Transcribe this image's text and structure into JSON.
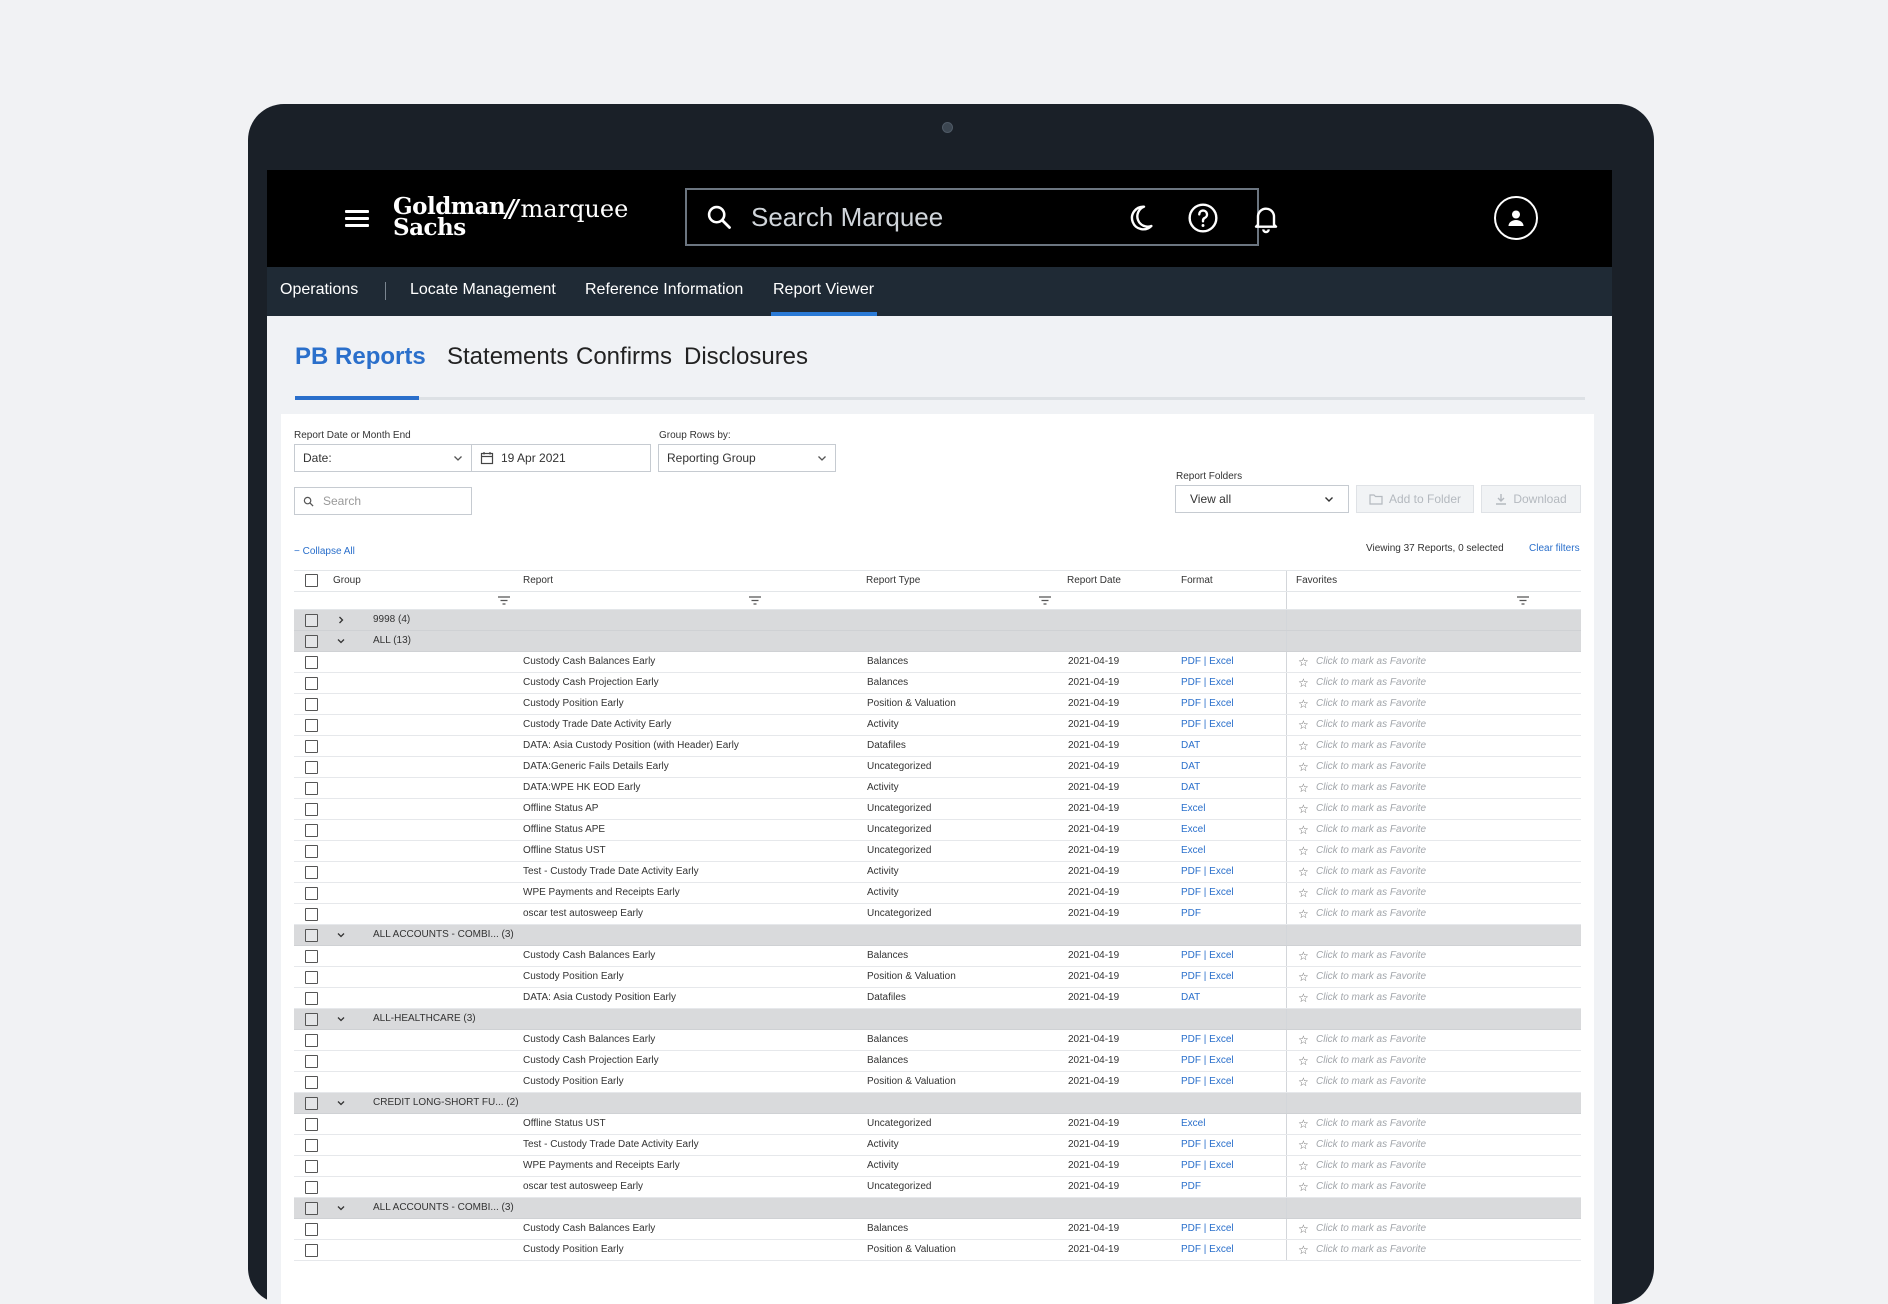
{
  "app": {
    "logo_line1": "Goldman",
    "logo_line2": "Sachs",
    "logo_product": "marquee",
    "search_placeholder": "Search Marquee"
  },
  "icons": [
    "menu-icon",
    "search-icon",
    "moon-icon",
    "help-icon",
    "bell-icon",
    "user-icon",
    "calendar-icon",
    "chevron-down-icon",
    "download-icon",
    "folder-icon",
    "filter-icon",
    "star-icon",
    "chevron-right-icon"
  ],
  "nav": [
    "Operations",
    "Locate Management",
    "Reference Information",
    "Report Viewer"
  ],
  "nav_active": "Report Viewer",
  "tabs": [
    "PB Reports",
    "Statements",
    "Confirms",
    "Disclosures"
  ],
  "tab_active": "PB Reports",
  "filters": {
    "date_label": "Report Date or Month End",
    "date_mode": "Date:",
    "date_value": "19 Apr 2021",
    "group_label": "Group Rows by:",
    "group_value": "Reporting Group",
    "search_placeholder": "Search",
    "folders_label": "Report Folders",
    "folders_value": "View all",
    "add_to_folder": "Add to Folder",
    "download": "Download",
    "collapse_all": "Collapse All",
    "viewing": "Viewing 37 Reports, 0 selected",
    "clear_filters": "Clear filters"
  },
  "columns": [
    "Group",
    "Report",
    "Report Type",
    "Report Date",
    "Format",
    "Favorites"
  ],
  "fav_text": "Click to mark as Favorite",
  "rows": [
    {
      "group": "9998 (4)",
      "expanded": false
    },
    {
      "group": "ALL (13)",
      "expanded": true
    },
    {
      "report": "Custody Cash Balances Early",
      "type": "Balances",
      "date": "2021-04-19",
      "format": "PDF | Excel"
    },
    {
      "report": "Custody Cash Projection Early",
      "type": "Balances",
      "date": "2021-04-19",
      "format": "PDF | Excel"
    },
    {
      "report": "Custody Position Early",
      "type": "Position & Valuation",
      "date": "2021-04-19",
      "format": "PDF | Excel"
    },
    {
      "report": "Custody Trade Date Activity Early",
      "type": "Activity",
      "date": "2021-04-19",
      "format": "PDF | Excel"
    },
    {
      "report": "DATA: Asia Custody Position (with Header) Early",
      "type": "Datafiles",
      "date": "2021-04-19",
      "format": "DAT"
    },
    {
      "report": "DATA:Generic Fails Details Early",
      "type": "Uncategorized",
      "date": "2021-04-19",
      "format": "DAT"
    },
    {
      "report": "DATA:WPE HK EOD Early",
      "type": "Activity",
      "date": "2021-04-19",
      "format": "DAT"
    },
    {
      "report": "Offline Status AP",
      "type": "Uncategorized",
      "date": "2021-04-19",
      "format": "Excel"
    },
    {
      "report": "Offline Status APE",
      "type": "Uncategorized",
      "date": "2021-04-19",
      "format": "Excel"
    },
    {
      "report": "Offline Status UST",
      "type": "Uncategorized",
      "date": "2021-04-19",
      "format": "Excel"
    },
    {
      "report": "Test - Custody Trade Date Activity Early",
      "type": "Activity",
      "date": "2021-04-19",
      "format": "PDF | Excel"
    },
    {
      "report": "WPE Payments and Receipts Early",
      "type": "Activity",
      "date": "2021-04-19",
      "format": "PDF | Excel"
    },
    {
      "report": "oscar test autosweep Early",
      "type": "Uncategorized",
      "date": "2021-04-19",
      "format": "PDF"
    },
    {
      "group": "ALL ACCOUNTS - COMBI... (3)",
      "expanded": true
    },
    {
      "report": "Custody Cash Balances Early",
      "type": "Balances",
      "date": "2021-04-19",
      "format": "PDF | Excel"
    },
    {
      "report": "Custody Position Early",
      "type": "Position & Valuation",
      "date": "2021-04-19",
      "format": "PDF | Excel"
    },
    {
      "report": "DATA: Asia Custody Position Early",
      "type": "Datafiles",
      "date": "2021-04-19",
      "format": "DAT"
    },
    {
      "group": "ALL-HEALTHCARE (3)",
      "expanded": true
    },
    {
      "report": "Custody Cash Balances Early",
      "type": "Balances",
      "date": "2021-04-19",
      "format": "PDF | Excel"
    },
    {
      "report": "Custody Cash Projection Early",
      "type": "Balances",
      "date": "2021-04-19",
      "format": "PDF | Excel"
    },
    {
      "report": "Custody Position Early",
      "type": "Position & Valuation",
      "date": "2021-04-19",
      "format": "PDF | Excel"
    },
    {
      "group": "CREDIT LONG-SHORT FU... (2)",
      "expanded": true
    },
    {
      "report": "Offline Status UST",
      "type": "Uncategorized",
      "date": "2021-04-19",
      "format": "Excel"
    },
    {
      "report": "Test - Custody Trade Date Activity Early",
      "type": "Activity",
      "date": "2021-04-19",
      "format": "PDF | Excel"
    },
    {
      "report": "WPE Payments and Receipts Early",
      "type": "Activity",
      "date": "2021-04-19",
      "format": "PDF | Excel"
    },
    {
      "report": "oscar test autosweep Early",
      "type": "Uncategorized",
      "date": "2021-04-19",
      "format": "PDF"
    },
    {
      "group": "ALL ACCOUNTS - COMBI... (3)",
      "expanded": true
    },
    {
      "report": "Custody Cash Balances Early",
      "type": "Balances",
      "date": "2021-04-19",
      "format": "PDF | Excel"
    },
    {
      "report": "Custody Position Early",
      "type": "Position & Valuation",
      "date": "2021-04-19",
      "format": "PDF | Excel"
    }
  ]
}
